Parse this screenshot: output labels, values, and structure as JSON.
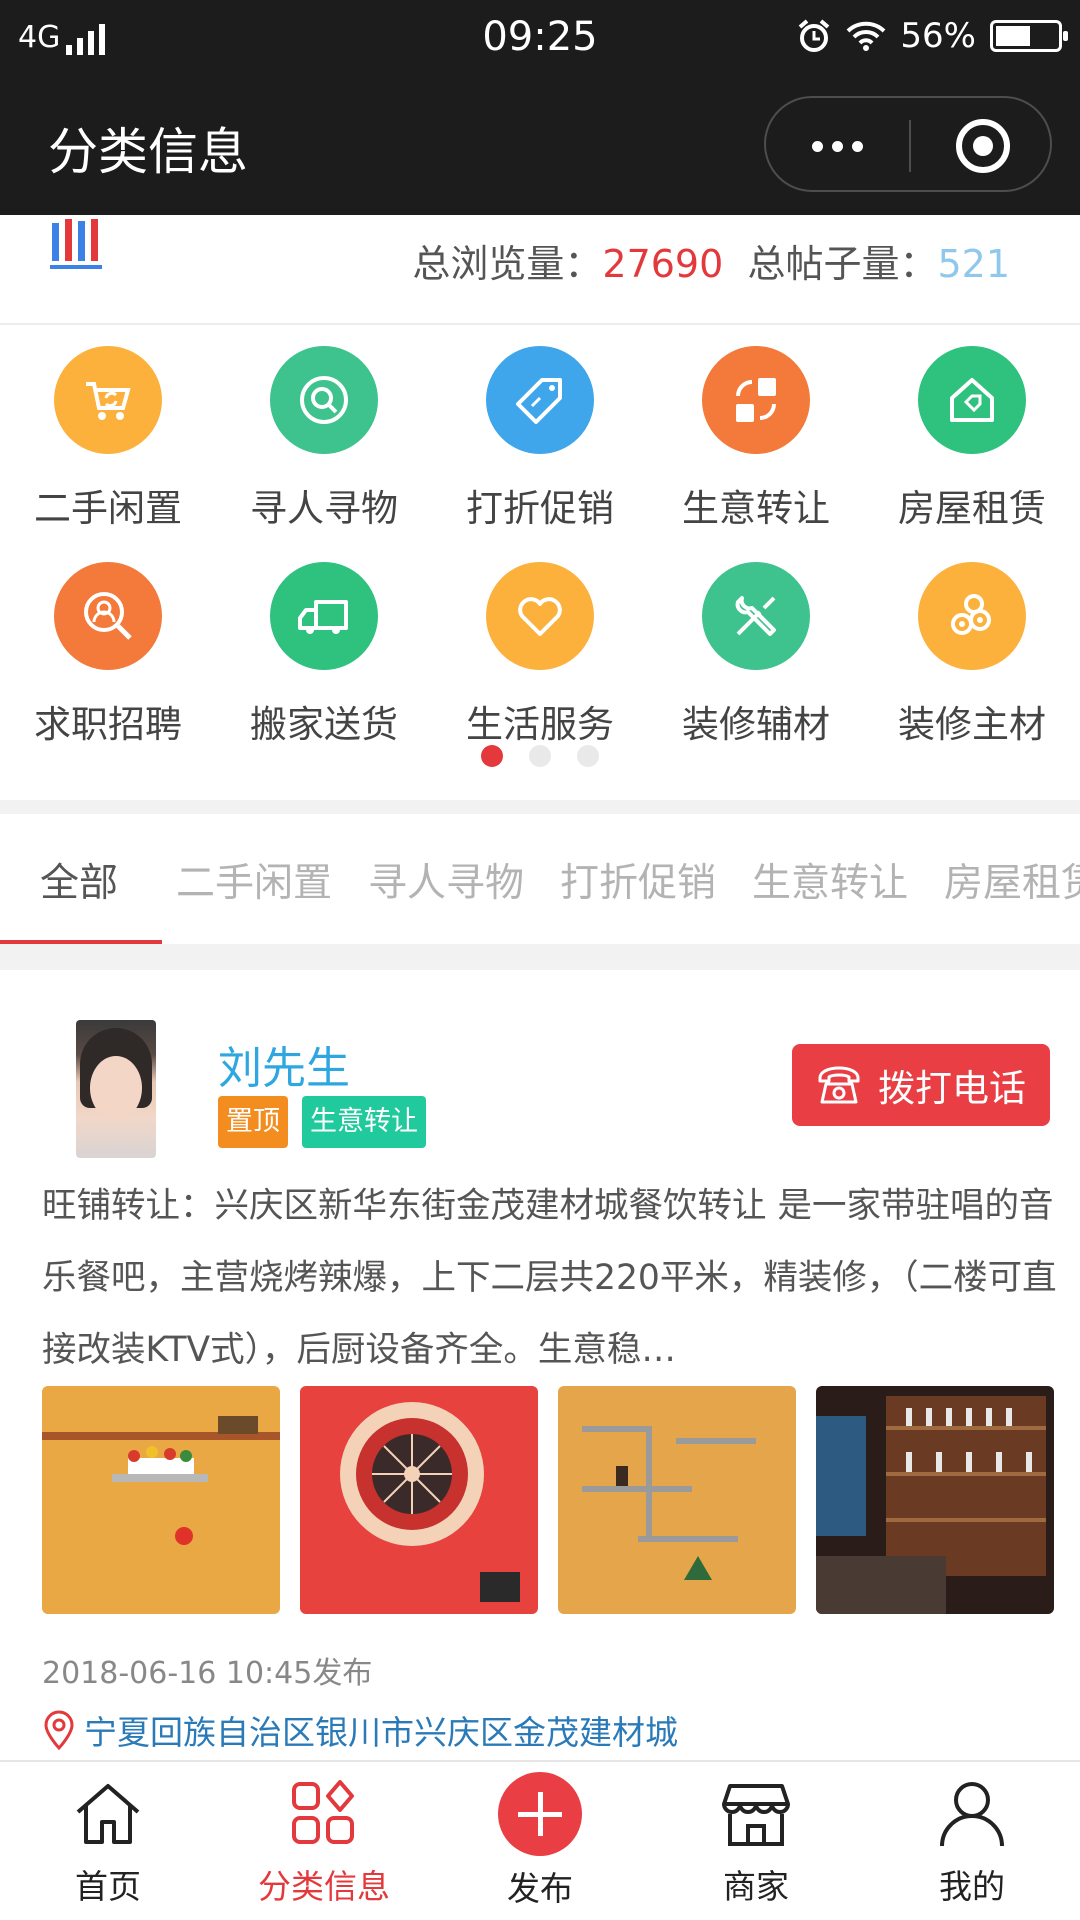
{
  "status_bar": {
    "network": "4G",
    "time": "09:25",
    "battery_pct_label": "56%",
    "battery_level": 0.56
  },
  "nav": {
    "title": "分类信息",
    "more_icon": "more-dots-icon",
    "close_icon": "target-close-icon"
  },
  "stats": {
    "views_label": "总浏览量：",
    "views_value": "27690",
    "posts_label": "总帖子量：",
    "posts_value": "521"
  },
  "categories": [
    {
      "label": "二手闲置",
      "icon": "cart-refresh-icon",
      "color": "#fbb13c"
    },
    {
      "label": "寻人寻物",
      "icon": "search-circle-icon",
      "color": "#3ec28e"
    },
    {
      "label": "打折促销",
      "icon": "price-tag-icon",
      "color": "#3fa6ec"
    },
    {
      "label": "生意转让",
      "icon": "transfer-blocks-icon",
      "color": "#f37a3a"
    },
    {
      "label": "房屋租赁",
      "icon": "house-tag-icon",
      "color": "#2fc27e"
    },
    {
      "label": "求职招聘",
      "icon": "person-search-icon",
      "color": "#f37a3a"
    },
    {
      "label": "搬家送货",
      "icon": "truck-icon",
      "color": "#2fc27e"
    },
    {
      "label": "生活服务",
      "icon": "heart-icon",
      "color": "#fbb13c"
    },
    {
      "label": "装修辅材",
      "icon": "tools-icon",
      "color": "#3ec28e"
    },
    {
      "label": "装修主材",
      "icon": "material-rolls-icon",
      "color": "#fbb13c"
    }
  ],
  "tabs": [
    "全部",
    "二手闲置",
    "寻人寻物",
    "打折促销",
    "生意转让",
    "房屋租赁"
  ],
  "post": {
    "author": "刘先生",
    "badge_top": "置顶",
    "badge_category": "生意转让",
    "call_label": "拨打电话",
    "body": "旺铺转让：兴庆区新华东街金茂建材城餐饮转让 是一家带驻唱的音乐餐吧，主营烧烤辣爆，上下二层共220平米，精装修，（二楼可直接改装KTV式），后厨设备齐全。生意稳…",
    "time": "2018-06-16 10:45发布",
    "location": "宁夏回族自治区银川市兴庆区金茂建材城"
  },
  "tabbar": [
    {
      "label": "首页",
      "icon": "home-icon"
    },
    {
      "label": "分类信息",
      "icon": "grid-icon"
    },
    {
      "label": "发布",
      "icon": "plus-icon"
    },
    {
      "label": "商家",
      "icon": "shop-icon"
    },
    {
      "label": "我的",
      "icon": "user-icon"
    }
  ],
  "colors": {
    "accent": "#e4393c",
    "author_blue": "#2ea7e0"
  }
}
